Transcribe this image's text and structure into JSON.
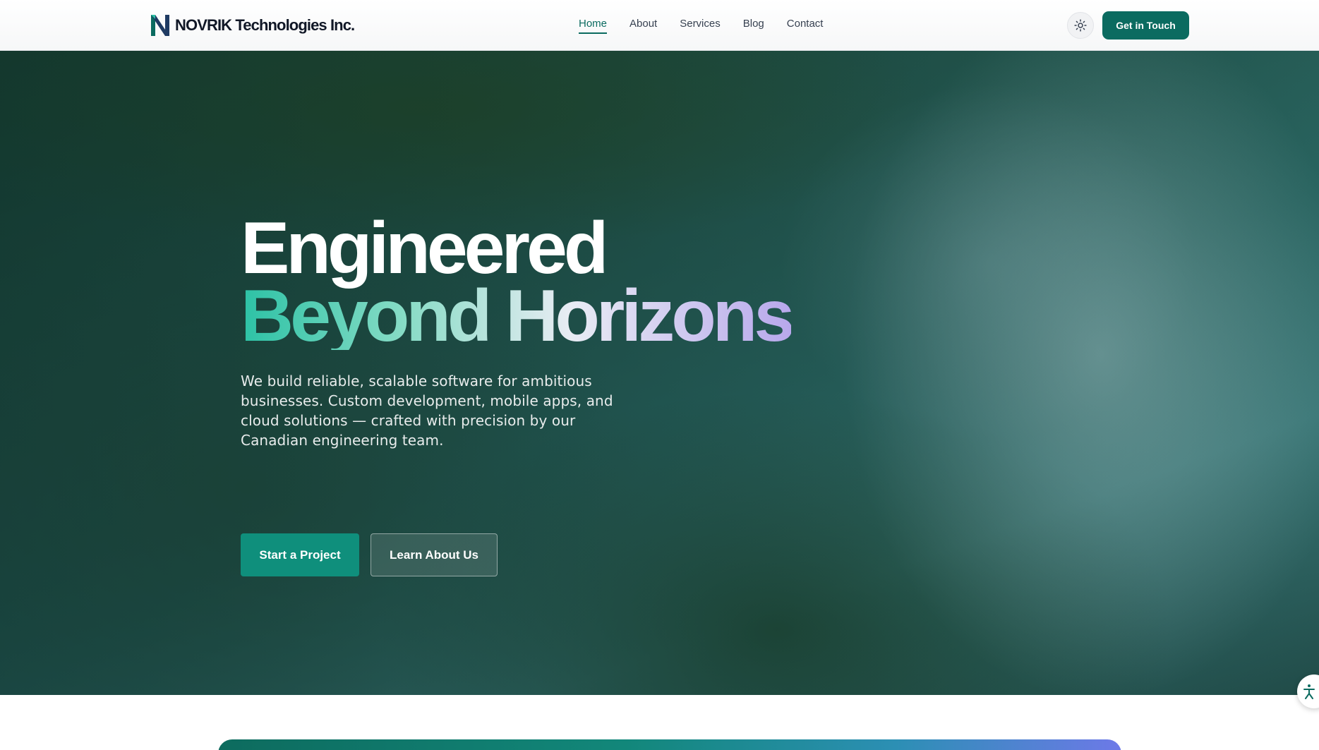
{
  "brand": {
    "name": "NOVRIK Technologies Inc.",
    "logo_icon": "n-monogram-logo",
    "accent": "#0b6b60"
  },
  "nav": {
    "items": [
      {
        "label": "Home",
        "active": true
      },
      {
        "label": "About",
        "active": false
      },
      {
        "label": "Services",
        "active": false
      },
      {
        "label": "Blog",
        "active": false
      },
      {
        "label": "Contact",
        "active": false
      }
    ]
  },
  "header": {
    "theme_toggle_icon": "sun-icon",
    "cta_label": "Get in Touch"
  },
  "hero": {
    "title_line1": "Engineered",
    "title_line2": "Beyond Horizons",
    "description": "We build reliable, scalable software for ambitious businesses. Custom development, mobile apps, and cloud solutions — crafted with precision by our Canadian engineering team.",
    "primary_button": "Start a Project",
    "secondary_button": "Learn About Us",
    "background": "waterfall-photo"
  },
  "accessibility": {
    "icon": "accessibility-icon"
  },
  "colors": {
    "primary": "#0b6b60",
    "button_teal": "#0f8f7c",
    "gradient_start": "#2cc2a5",
    "gradient_end": "#b8a8ec"
  }
}
